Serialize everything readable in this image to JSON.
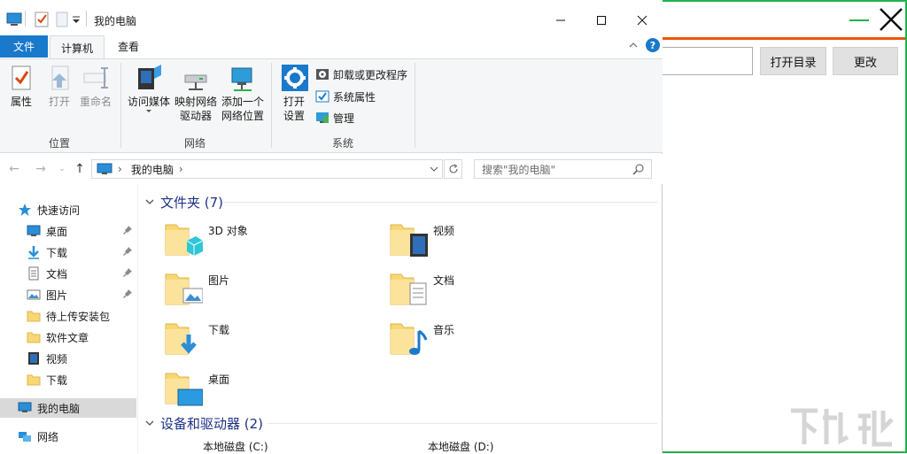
{
  "window": {
    "title": "我的电脑"
  },
  "ribbon": {
    "tabs": {
      "file": "文件",
      "computer": "计算机",
      "view": "查看"
    },
    "help": "?",
    "groups": {
      "location": {
        "label": "位置",
        "buttons": {
          "properties": "属性",
          "open": "打开",
          "rename": "重命名"
        }
      },
      "network": {
        "label": "网络",
        "buttons": {
          "media": "访问媒体",
          "map_drive_1": "映射网络",
          "map_drive_2": "驱动器",
          "add_location_1": "添加一个",
          "add_location_2": "网络位置"
        }
      },
      "system": {
        "label": "系统",
        "open_settings_1": "打开",
        "open_settings_2": "设置",
        "uninstall": "卸载或更改程序",
        "sys_props": "系统属性",
        "manage": "管理"
      }
    }
  },
  "address": {
    "path": "我的电脑",
    "search_placeholder": "搜索\"我的电脑\""
  },
  "nav": {
    "quick_access": "快速访问",
    "items": [
      {
        "label": "桌面",
        "icon": "desktop-icon",
        "pinned": true
      },
      {
        "label": "下载",
        "icon": "download-icon",
        "pinned": true
      },
      {
        "label": "文档",
        "icon": "document-icon",
        "pinned": true
      },
      {
        "label": "图片",
        "icon": "picture-icon",
        "pinned": true
      },
      {
        "label": "待上传安装包",
        "icon": "folder-icon",
        "pinned": false
      },
      {
        "label": "软件文章",
        "icon": "folder-icon",
        "pinned": false
      },
      {
        "label": "视频",
        "icon": "video-icon",
        "pinned": false
      },
      {
        "label": "下载",
        "icon": "folder-icon",
        "pinned": false
      }
    ],
    "this_pc": "我的电脑",
    "network": "网络"
  },
  "content": {
    "folders_header": "文件夹 (7)",
    "folders": [
      {
        "label": "3D 对象",
        "overlay": "cube"
      },
      {
        "label": "视频",
        "overlay": "film"
      },
      {
        "label": "图片",
        "overlay": "picture"
      },
      {
        "label": "文档",
        "overlay": "doc"
      },
      {
        "label": "下载",
        "overlay": "arrow"
      },
      {
        "label": "音乐",
        "overlay": "note"
      },
      {
        "label": "桌面",
        "overlay": "screen"
      }
    ],
    "devices_header": "设备和驱动器 (2)",
    "drives": [
      {
        "label": "本地磁盘 (C:)"
      },
      {
        "label": "本地磁盘 (D:)"
      }
    ]
  },
  "background_app": {
    "open_dir_button": "打开目录",
    "change_button": "更改",
    "watermark": "下载吧",
    "accent_green": "#21b24b",
    "accent_orange": "#e8590c"
  }
}
